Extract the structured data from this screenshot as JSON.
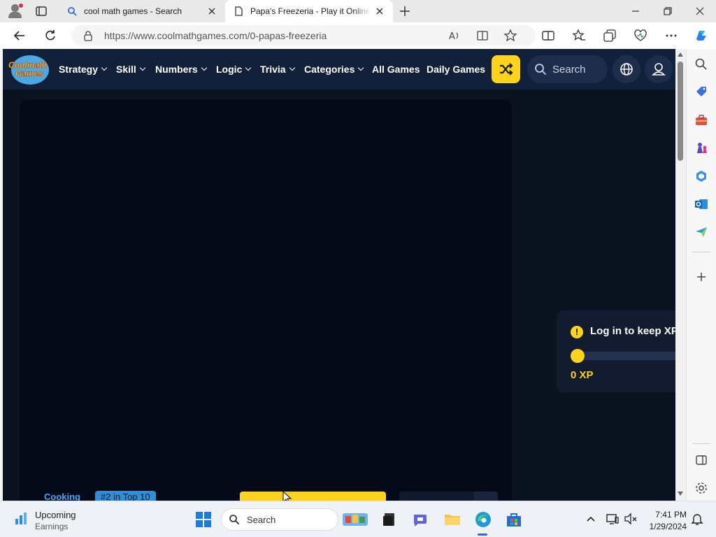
{
  "browser": {
    "tabs": [
      {
        "title": "cool math games - Search",
        "favicon": "search-icon",
        "active": false
      },
      {
        "title": "Papa's Freezeria - Play it Online at Coolmath Games",
        "favicon": "page-icon",
        "active": true
      }
    ],
    "address_bar": {
      "url": "https://www.coolmathgames.com/0-papas-freezeria"
    }
  },
  "site": {
    "logo_line1": "Coolmath",
    "logo_line2": "Games",
    "nav": [
      {
        "label": "Strategy",
        "has_dropdown": true
      },
      {
        "label": "Skill",
        "has_dropdown": true
      },
      {
        "label": "Numbers",
        "has_dropdown": true
      },
      {
        "label": "Logic",
        "has_dropdown": true
      },
      {
        "label": "Trivia",
        "has_dropdown": true
      },
      {
        "label": "Categories",
        "has_dropdown": true
      },
      {
        "label": "All Games",
        "has_dropdown": false
      },
      {
        "label": "Daily Games",
        "has_dropdown": false
      }
    ],
    "search_placeholder": "Search",
    "xp_panel": {
      "message": "Log in to keep XP",
      "xp_label": "0 XP",
      "progress": 0
    },
    "game_tags": {
      "category": "Cooking",
      "rank": "#2 in Top 10"
    }
  },
  "taskbar": {
    "widget_title": "Upcoming",
    "widget_subtitle": "Earnings",
    "search_label": "Search",
    "time": "7:41 PM",
    "date": "1/29/2024"
  },
  "colors": {
    "site_nav_bg": "#13203a",
    "accent_yellow": "#ffd31a",
    "game_bg": "#040a18"
  }
}
